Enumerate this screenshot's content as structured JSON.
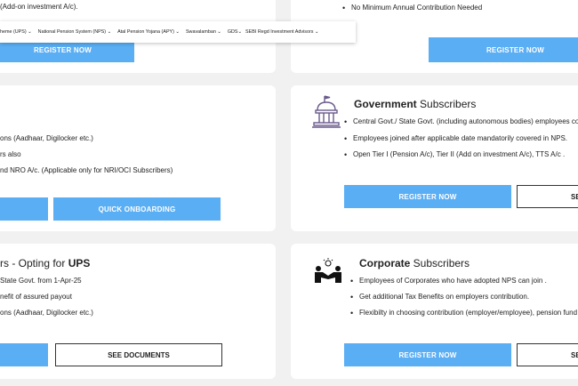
{
  "top_left": {
    "partial_text": "(Add-on investment A/c).",
    "register_label": "REGISTER NOW"
  },
  "top_right": {
    "bullet": "No Minimum Annual Contribution Needed",
    "register_label": "REGISTER NOW"
  },
  "nav": {
    "items": [
      "heme (UPS) ⌄",
      "National Pension System (NPS) ⌄",
      "Atal Pension Yojana (APY) ⌄",
      "Swavalamban ⌄",
      "GDS⌄",
      "SEBI Regd Investment Advisors ⌄"
    ]
  },
  "mid_left": {
    "lines": [
      "ons (Aadhaar, Digilocker etc.)",
      "rs also",
      "nd NRO A/c. (Applicable only for NRI/OCI Subscribers)"
    ],
    "quick_label": "QUICK ONBOARDING"
  },
  "government": {
    "title_bold": "Government",
    "title_rest": " Subscribers",
    "icon": "government-building-icon",
    "bullets": [
      "Central Govt./ State Govt. (including autonomous bodies) employees cov",
      "Employees joined after applicable date mandatorily covered in NPS.",
      "Open Tier I (Pension A/c), Tier II (Add on investment A/c), TTS A/c ."
    ],
    "register_label": "REGISTER NOW",
    "see_label": "SE"
  },
  "ups": {
    "title_prefix": "rs - Opting for ",
    "title_bold": "UPS",
    "lines": [
      "State Govt. from 1-Apr-25",
      "nefit of assured payout",
      "ons (Aadhaar, Digilocker etc.)"
    ],
    "see_documents_label": "SEE DOCUMENTS"
  },
  "corporate": {
    "title_bold": "Corporate",
    "title_rest": " Subscribers",
    "icon": "corporate-handshake-icon",
    "bullets": [
      "Employees of Corporates who have adopted NPS can join .",
      "Get additional Tax Benefits on employers contribution.",
      "Flexibilty in choosing contribution (employer/employee), pension fund"
    ],
    "register_label": "REGISTER NOW",
    "see_label": "SE"
  },
  "colors": {
    "button_blue": "#5aaef4",
    "icon_purple": "#6a5a8c",
    "background": "#f1f1f1"
  }
}
